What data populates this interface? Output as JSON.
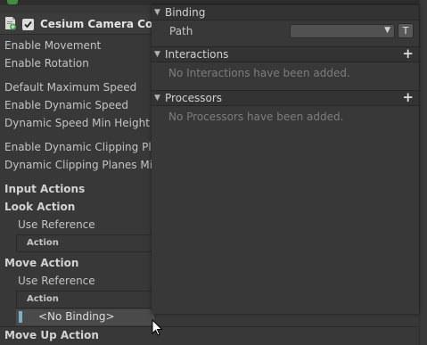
{
  "inspector": {
    "component": {
      "title": "Cesium Camera Cont",
      "enabled": true,
      "icon": "script-component-icon",
      "check_icon": "checkmark-icon"
    },
    "fields": {
      "enable_movement": "Enable Movement",
      "enable_rotation": "Enable Rotation",
      "default_max_speed": "Default Maximum Speed",
      "enable_dynamic_speed": "Enable Dynamic Speed",
      "dynamic_speed_min_height": "Dynamic Speed Min Height",
      "enable_dynamic_clipping": "Enable Dynamic Clipping Plar",
      "dynamic_clipping_min": "Dynamic Clipping Planes Min"
    },
    "input_actions": {
      "header": "Input Actions",
      "look_action": {
        "label": "Look Action",
        "use_reference": "Use Reference",
        "action_header": "Action"
      },
      "move_action": {
        "label": "Move Action",
        "use_reference": "Use Reference",
        "action_header": "Action",
        "binding": "<No Binding>"
      },
      "move_up_action": {
        "label": "Move Up Action"
      }
    }
  },
  "binding_panel": {
    "binding": {
      "title": "Binding",
      "path_label": "Path",
      "path_value": "",
      "t_button": "T"
    },
    "interactions": {
      "title": "Interactions",
      "empty": "No Interactions have been added."
    },
    "processors": {
      "title": "Processors",
      "empty": "No Processors have been added."
    }
  },
  "colors": {
    "background": "#383838",
    "section_header": "#333333",
    "binding_marker": "#7bb0c9",
    "muted_text": "#7d7d7d"
  }
}
